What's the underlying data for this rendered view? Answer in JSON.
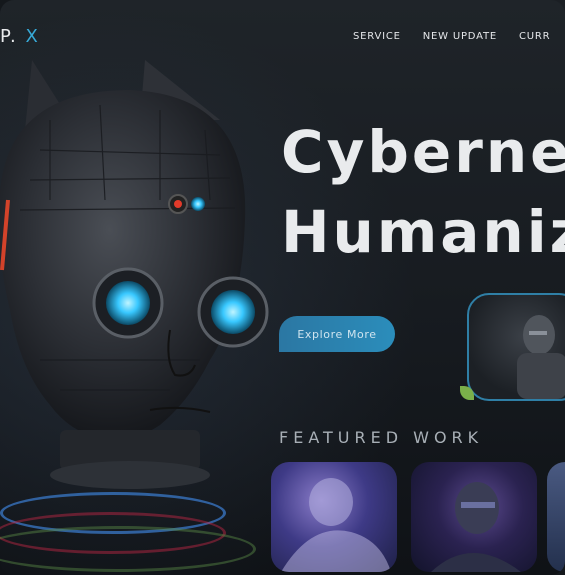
{
  "brand": {
    "logo_main": "P.",
    "logo_accent": "X"
  },
  "nav": {
    "items": [
      "SERVICE",
      "NEW UPDATE",
      "CURR"
    ]
  },
  "hero": {
    "headline_line1": "Cyberne",
    "headline_line2": "Humaniz",
    "cta_label": "Explore More"
  },
  "featured": {
    "title": "FEATURED WORK"
  },
  "colors": {
    "accent": "#2b8dbb",
    "leaf": "#7bb04a",
    "eye_glow": "#38c8ff"
  },
  "icons": [
    "robot-head-illustration",
    "robot-figure-thumbnail",
    "leaf-icon"
  ]
}
